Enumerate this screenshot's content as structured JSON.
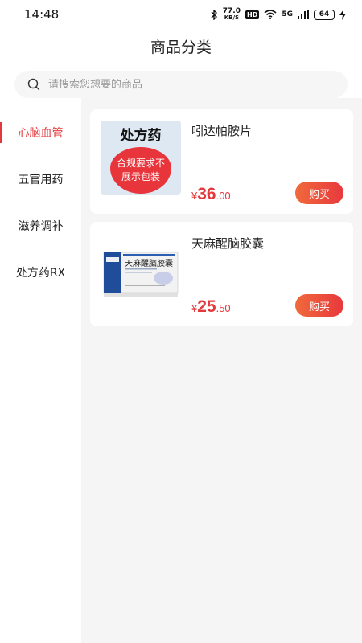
{
  "status_bar": {
    "time": "14:48",
    "net_speed_value": "77.0",
    "net_speed_unit": "KB/S",
    "hd_label": "HD",
    "signal_label": "5G",
    "battery": "64",
    "icons": [
      "bluetooth-icon",
      "wifi-icon",
      "signal-icon",
      "battery-icon",
      "charging-icon"
    ]
  },
  "header": {
    "title": "商品分类"
  },
  "search": {
    "placeholder": "请搜索您想要的商品"
  },
  "sidebar": {
    "items": [
      {
        "label": "心脑血管",
        "active": true
      },
      {
        "label": "五官用药",
        "active": false
      },
      {
        "label": "滋养调补",
        "active": false
      },
      {
        "label": "处方药RX",
        "active": false
      }
    ]
  },
  "products": [
    {
      "name": "吲达帕胺片",
      "image_rx_title": "处方药",
      "image_rx_notice": "合规要求不展示包装",
      "price_symbol": "¥",
      "price_int": "36",
      "price_dec": ".00",
      "buy_label": "购买"
    },
    {
      "name": "天麻醒脑胶囊",
      "image_brand": "天麻醒脑胶囊",
      "price_symbol": "¥",
      "price_int": "25",
      "price_dec": ".50",
      "buy_label": "购买"
    }
  ],
  "colors": {
    "accent": "#e4393c",
    "button_start": "#f06a3b",
    "button_end": "#e8383d",
    "content_bg": "#f5f5f5"
  }
}
